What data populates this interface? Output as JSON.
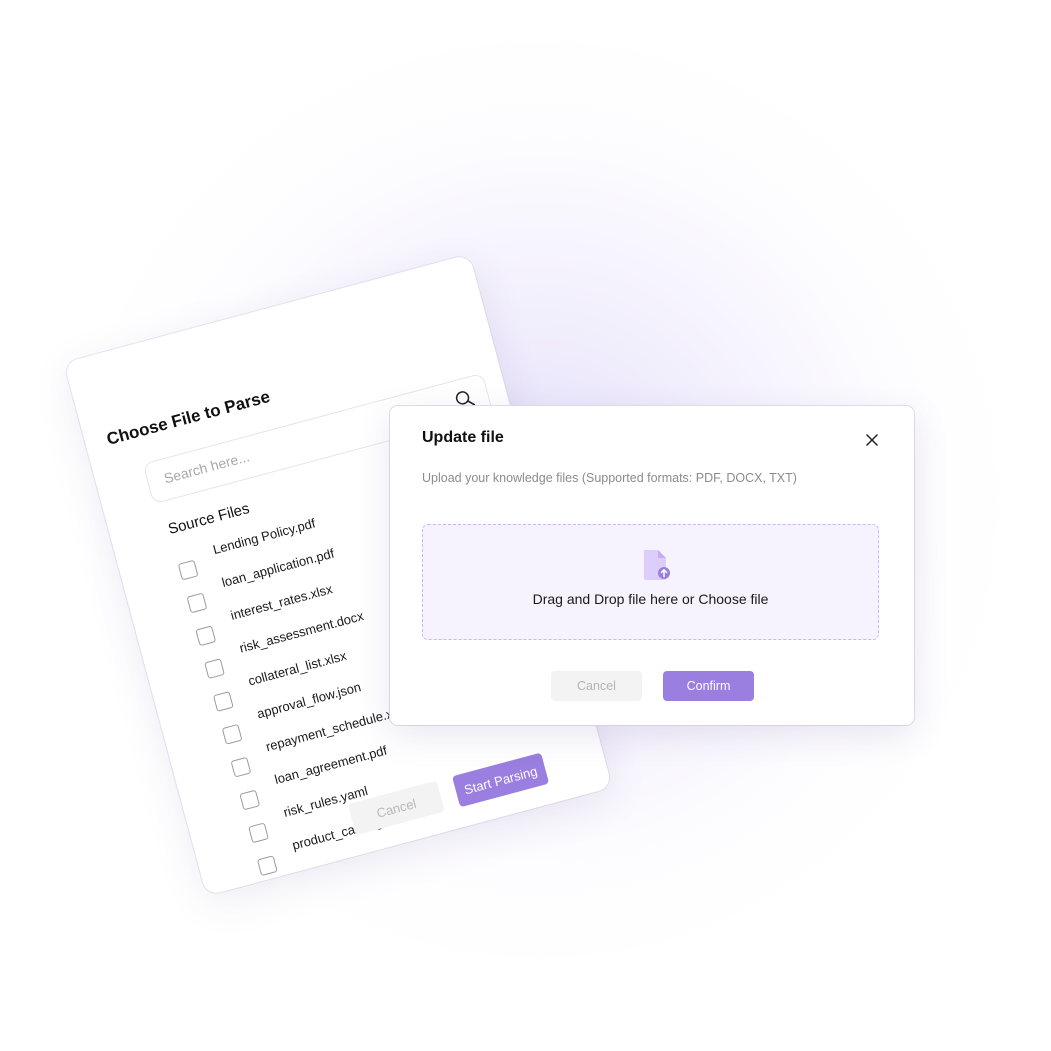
{
  "parse_dialog": {
    "title": "Choose File to Parse",
    "search_placeholder": "Search here...",
    "section_title": "Source Files",
    "files": [
      "Lending Policy.pdf",
      "loan_application.pdf",
      "interest_rates.xlsx",
      "risk_assessment.docx",
      "collateral_list.xlsx",
      "approval_flow.json",
      "repayment_schedule.xlsx",
      "loan_agreement.pdf",
      "risk_rules.yaml",
      "product_catalog.xlsx"
    ],
    "cancel_label": "Cancel",
    "start_label": "Start Parsing"
  },
  "update_dialog": {
    "title": "Update file",
    "description": "Upload your knowledge files (Supported formats: PDF, DOCX, TXT)",
    "dropzone_text": "Drag and Drop file here or Choose file",
    "cancel_label": "Cancel",
    "confirm_label": "Confirm"
  },
  "icons": {
    "search": "search-icon",
    "close": "close-icon",
    "upload": "file-upload-icon"
  },
  "colors": {
    "accent": "#9a7ee0",
    "dropzone_bg": "#f6f3fe",
    "dropzone_border": "#c7b8f0"
  }
}
